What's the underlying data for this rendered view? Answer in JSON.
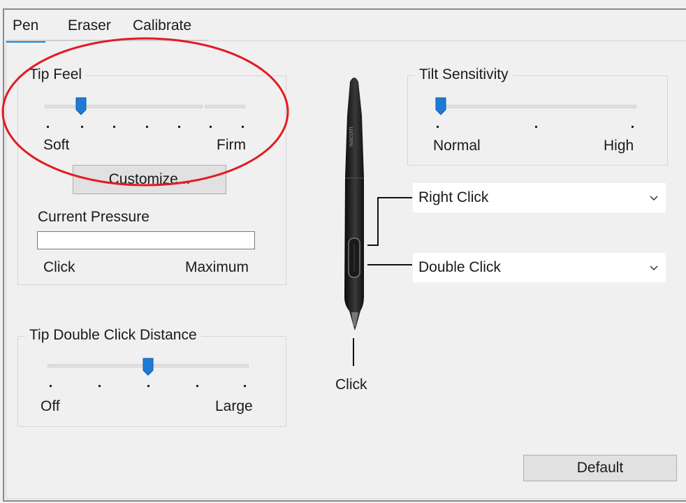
{
  "tabs": [
    "Pen",
    "Eraser",
    "Calibrate"
  ],
  "tip_feel": {
    "title": "Tip Feel",
    "min_label": "Soft",
    "max_label": "Firm",
    "level": "2 of 7",
    "customize_label": "Customize..."
  },
  "current_pressure": {
    "title": "Current Pressure",
    "min_label": "Click",
    "max_label": "Maximum"
  },
  "tip_double_click": {
    "title": "Tip Double Click Distance",
    "min_label": "Off",
    "max_label": "Large",
    "level": "3 of 5"
  },
  "tilt": {
    "title": "Tilt Sensitivity",
    "min_label": "Normal",
    "max_label": "High",
    "level": "1 of 3"
  },
  "pen": {
    "brand": "wacom",
    "tip_label": "Click"
  },
  "side_switch": {
    "upper": "Right Click",
    "lower": "Double Click"
  },
  "default_label": "Default",
  "colors": {
    "accent": "#1683d8",
    "thumb": "#1f7ad6",
    "highlight_ring": "#e31b23"
  },
  "icons": [
    "chevron-down-icon",
    "pen-icon",
    "slider-thumb"
  ]
}
